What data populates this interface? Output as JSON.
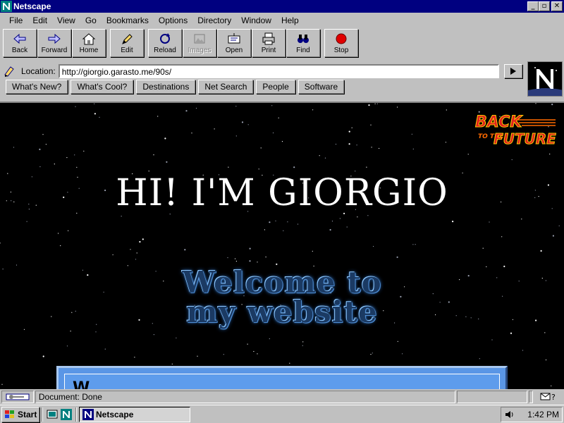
{
  "window": {
    "title": "Netscape"
  },
  "menu": [
    "File",
    "Edit",
    "View",
    "Go",
    "Bookmarks",
    "Options",
    "Directory",
    "Window",
    "Help"
  ],
  "toolbar": {
    "back": "Back",
    "forward": "Forward",
    "home": "Home",
    "edit": "Edit",
    "reload": "Reload",
    "images": "Images",
    "open": "Open",
    "print": "Print",
    "find": "Find",
    "stop": "Stop"
  },
  "location": {
    "label": "Location:",
    "url": "http://giorgio.garasto.me/90s/"
  },
  "directory_buttons": [
    "What's New?",
    "What's Cool?",
    "Destinations",
    "Net Search",
    "People",
    "Software"
  ],
  "page": {
    "headline": "HI! I'M GIORGIO",
    "welcome_line1": "Welcome to",
    "welcome_line2": "my website",
    "logo_text_top": "BACK",
    "logo_text_mid": "TO THE",
    "logo_text_bottom": "FUTURE",
    "panel_text": "W"
  },
  "status": {
    "text": "Document: Done"
  },
  "taskbar": {
    "start": "Start",
    "task": "Netscape",
    "clock": "1:42 PM"
  },
  "colors": {
    "titlebar": "#000080",
    "panel": "#5a96e6",
    "stop": "#e00000"
  }
}
